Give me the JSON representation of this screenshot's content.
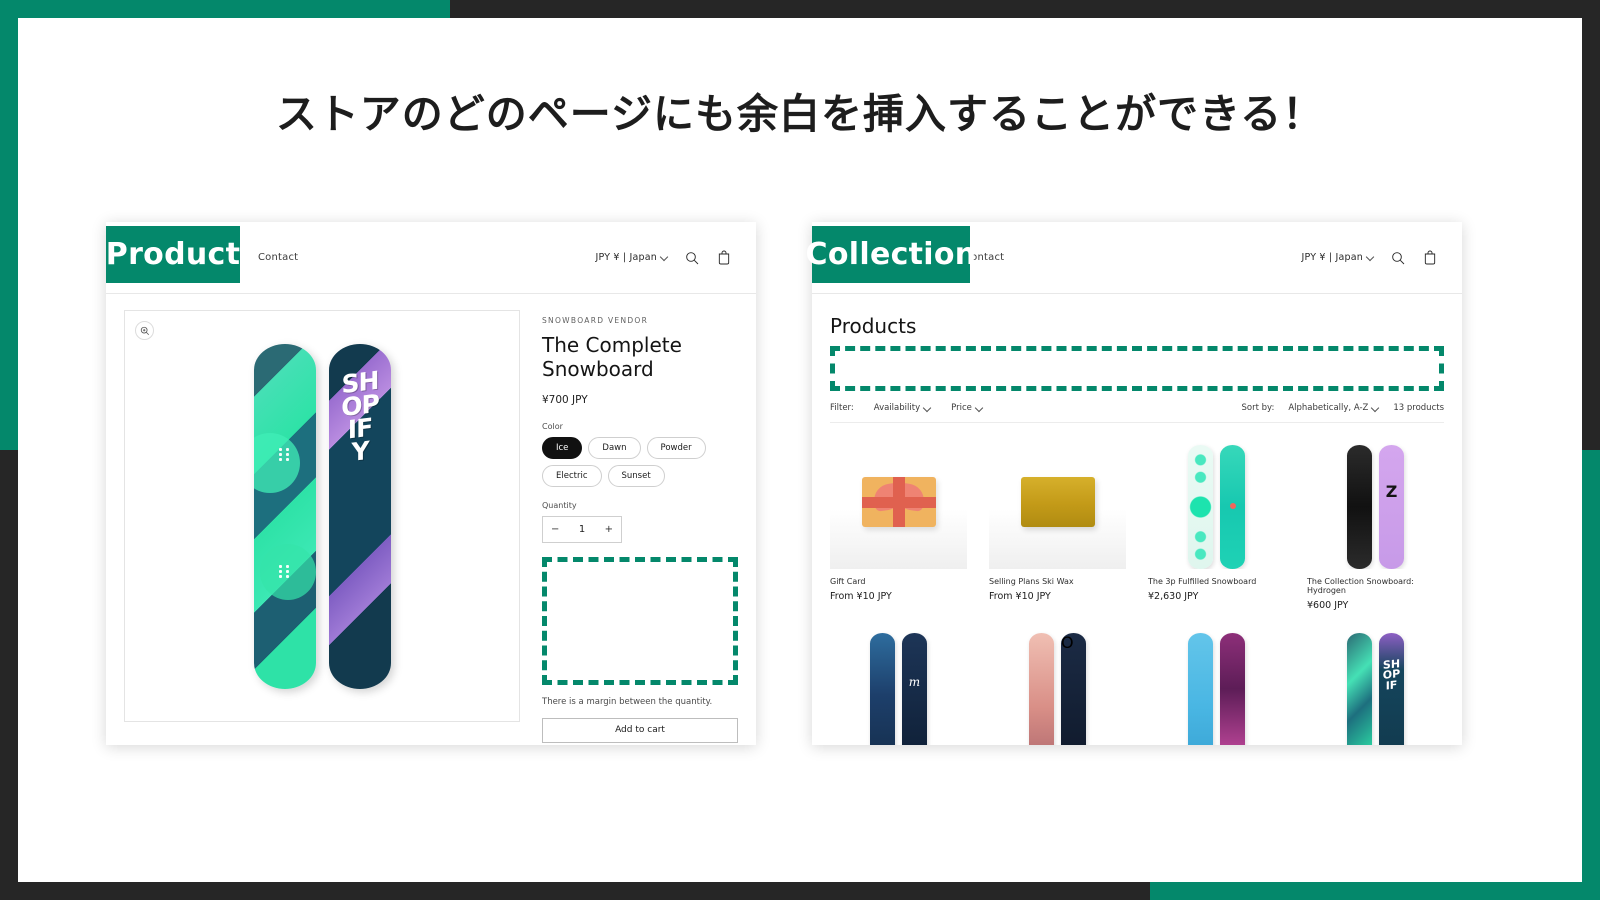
{
  "headline": "ストアのどのページにも余白を挿入することができる！",
  "frame_colors": {
    "green": "#04886B",
    "dark": "#262626"
  },
  "product_panel": {
    "badge_label": "Product",
    "header": {
      "nav_link": "Contact",
      "currency": "JPY ¥ | Japan",
      "search_icon": "search-icon",
      "cart_icon": "cart-icon",
      "chevron_icon": "chevron-down-icon"
    },
    "gallery": {
      "zoom_icon": "zoom-in-icon",
      "board_logotype_lines": [
        "SH",
        "OP",
        "IF",
        "Y"
      ]
    },
    "info": {
      "vendor": "SNOWBOARD VENDOR",
      "title": "The Complete Snowboard",
      "price": "¥700 JPY",
      "color_label": "Color",
      "color_options": [
        {
          "label": "Ice",
          "selected": true
        },
        {
          "label": "Dawn",
          "selected": false
        },
        {
          "label": "Powder",
          "selected": false
        },
        {
          "label": "Electric",
          "selected": false
        },
        {
          "label": "Sunset",
          "selected": false
        }
      ],
      "quantity_label": "Quantity",
      "quantity_value": "1",
      "quantity_minus": "−",
      "quantity_plus": "+",
      "margin_caption": "There is a margin between the quantity.",
      "add_to_cart_label": "Add to cart"
    }
  },
  "collection_panel": {
    "badge_label": "Collection",
    "header": {
      "nav_link": "Contact",
      "currency": "JPY ¥ | Japan",
      "search_icon": "search-icon",
      "cart_icon": "cart-icon",
      "chevron_icon": "chevron-down-icon"
    },
    "title": "Products",
    "filterbar": {
      "filter_label": "Filter:",
      "availability_label": "Availability",
      "price_label": "Price",
      "sort_by_label": "Sort by:",
      "sort_value": "Alphabetically, A-Z",
      "product_count": "13 products"
    },
    "products_row1": [
      {
        "name": "Gift Card",
        "price": "From ¥10 JPY"
      },
      {
        "name": "Selling Plans Ski Wax",
        "price": "From ¥10 JPY"
      },
      {
        "name": "The 3p Fulfilled Snowboard",
        "price": "¥2,630 JPY"
      },
      {
        "name": "The Collection Snowboard: Hydrogen",
        "price": "¥600 JPY"
      }
    ]
  }
}
